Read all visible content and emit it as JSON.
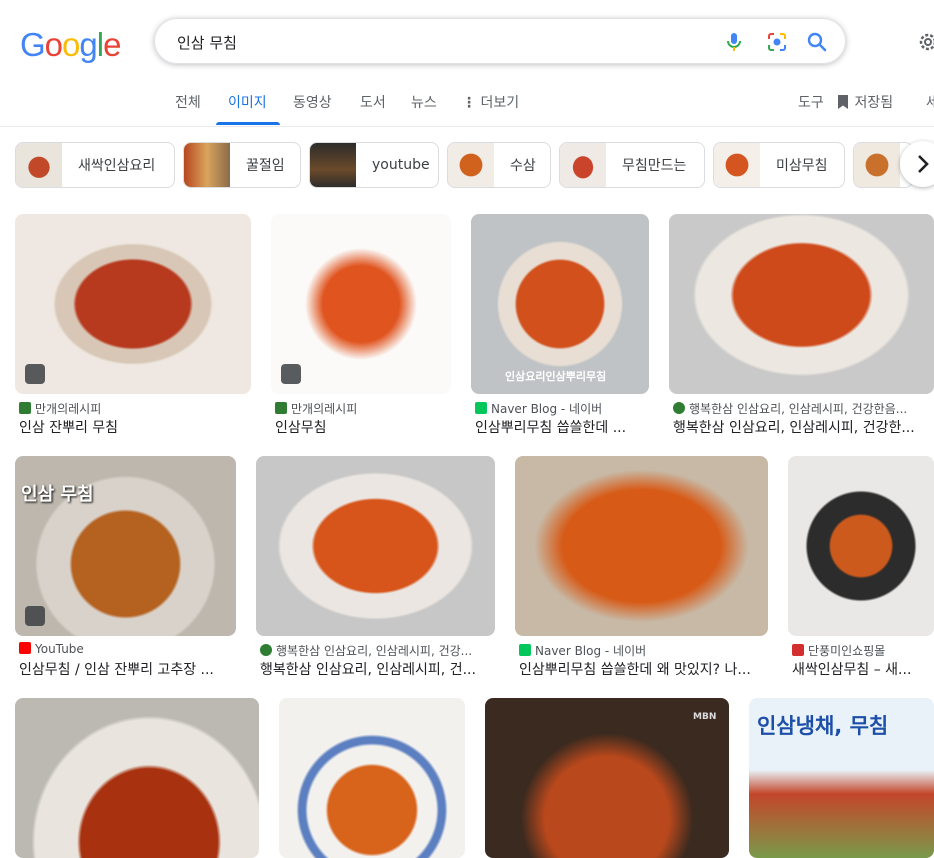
{
  "logo": {
    "letters": [
      "G",
      "o",
      "o",
      "g",
      "l",
      "e"
    ],
    "colors": [
      "#4285F4",
      "#EA4335",
      "#FBBC05",
      "#4285F4",
      "#34A853",
      "#EA4335"
    ]
  },
  "search": {
    "query": "인삼 무침"
  },
  "icons": {
    "mic": "mic-icon",
    "lens": "lens-icon",
    "search": "search-icon",
    "settings": "gear-icon",
    "bookmark": "bookmark-icon",
    "more": "more-vert-icon",
    "chevron": "chevron-right-icon"
  },
  "tabs": [
    {
      "label": "전체"
    },
    {
      "label": "이미지"
    },
    {
      "label": "동영상"
    },
    {
      "label": "도서"
    },
    {
      "label": "뉴스"
    },
    {
      "label": "더보기"
    }
  ],
  "tools": {
    "label": "도구",
    "saved": "저장됨",
    "cut": "세"
  },
  "chips": [
    {
      "label": "새싹인삼요리"
    },
    {
      "label": "꿀절임"
    },
    {
      "label": "youtube"
    },
    {
      "label": "수삼"
    },
    {
      "label": "무침만드는"
    },
    {
      "label": "미삼무침"
    }
  ],
  "results": [
    {
      "source": "만개의레시피",
      "title": "인삼 잔뿌리 무침"
    },
    {
      "source": "만개의레시피",
      "title": "인삼무침"
    },
    {
      "source": "Naver Blog - 네이버",
      "title": "인삼뿌리무침 씁쓸한데 ...",
      "overlay": "인삼요리인삼뿌리무침"
    },
    {
      "source": "행복한삼 인삼요리, 인삼레시피, 건강한음...",
      "title": "행복한삼 인삼요리, 인삼레시피, 건강한..."
    },
    {
      "source": "YouTube",
      "title": "인삼무침 / 인삼 잔뿌리 고추장 ...",
      "overlay": "인삼 무침"
    },
    {
      "source": "행복한삼 인삼요리, 인삼레시피, 건강...",
      "title": "행복한삼 인삼요리, 인삼레시피, 건..."
    },
    {
      "source": "Naver Blog - 네이버",
      "title": "인삼뿌리무침 씁쓸한데 왜 맛있지? 나..."
    },
    {
      "source": "단풍미인쇼핑몰",
      "title": "새싹인삼무침 – 새..."
    },
    {
      "source": "",
      "title": ""
    },
    {
      "source": "",
      "title": ""
    },
    {
      "source": "",
      "title": "",
      "overlay": "MBN"
    },
    {
      "source": "",
      "title": "",
      "overlay": "인삼냉채, 무침"
    }
  ],
  "colors": {
    "accent": "#1a73e8",
    "naver": "#03c75a",
    "youtube": "#ff0000",
    "recipe": "#2e7d32"
  }
}
